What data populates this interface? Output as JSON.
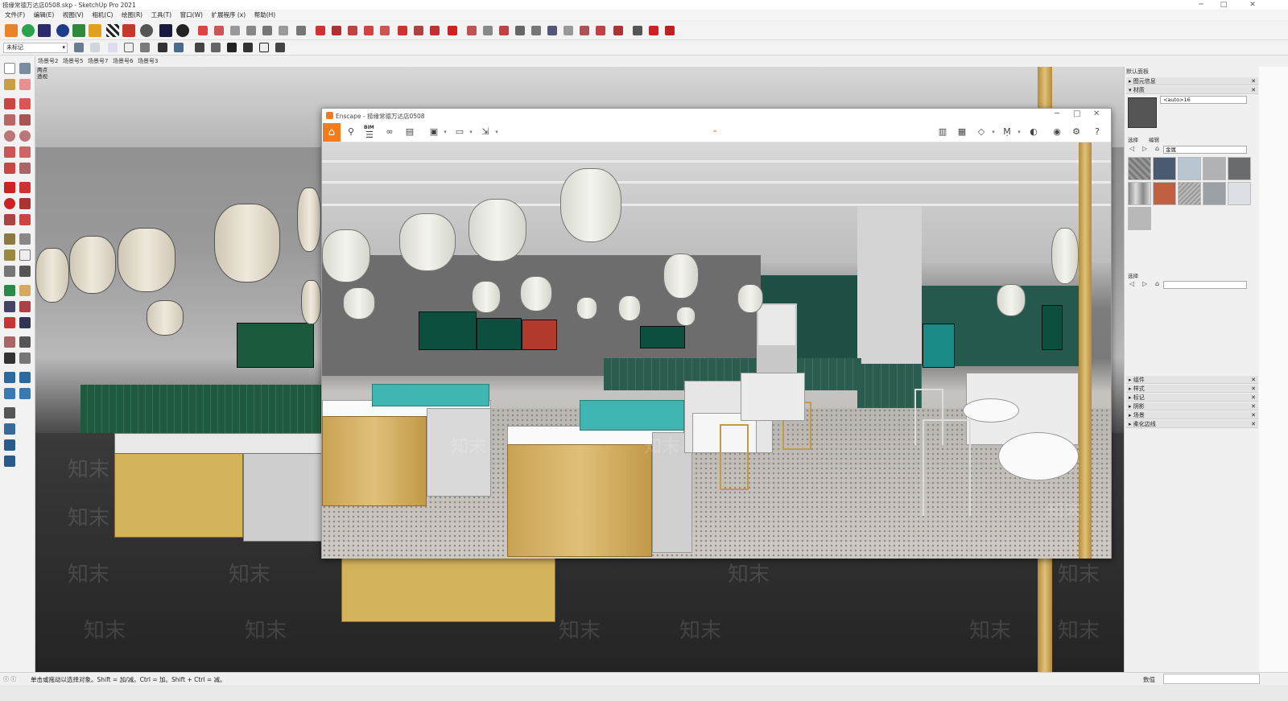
{
  "window": {
    "title": "捞缘常德万达店0508.skp - SketchUp Pro 2021",
    "controls": [
      "─",
      "□",
      "✕"
    ]
  },
  "menu": [
    "文件(F)",
    "编辑(E)",
    "视图(V)",
    "相机(C)",
    "绘图(R)",
    "工具(T)",
    "窗口(W)",
    "扩展程序 (x)",
    "帮助(H)"
  ],
  "tag_select": {
    "value": "未标记"
  },
  "scenes": [
    "场景号2",
    "场景号5",
    "场景号7",
    "场景号6",
    "场景号3"
  ],
  "viewport": {
    "camera_label_1": "两点",
    "camera_label_2": "透视"
  },
  "watermark": "知末",
  "enscape": {
    "title": "Enscape - 捞缘常德万达店0508",
    "bim_label": "BIM",
    "controls": [
      "─",
      "□",
      "✕"
    ]
  },
  "tray": {
    "header": "默认面板",
    "entity_info": "图元信息",
    "materials": "材质",
    "material_name": "<auto>16",
    "tab_select": "选择",
    "tab_edit": "编辑",
    "library": "金属",
    "select_label": "选择",
    "collapsed": [
      "组件",
      "样式",
      "标记",
      "阴影",
      "场景",
      "柔化边线"
    ]
  },
  "status": {
    "message": "单击或拖动以选择对象。Shift = 加/减。Ctrl = 加。Shift + Ctrl = 减。",
    "measure_label": "数值"
  },
  "colors": {
    "enscape_orange": "#f27c1b",
    "restaurant_green": "#1f4e44",
    "banner_teal": "#3fb6b2"
  }
}
